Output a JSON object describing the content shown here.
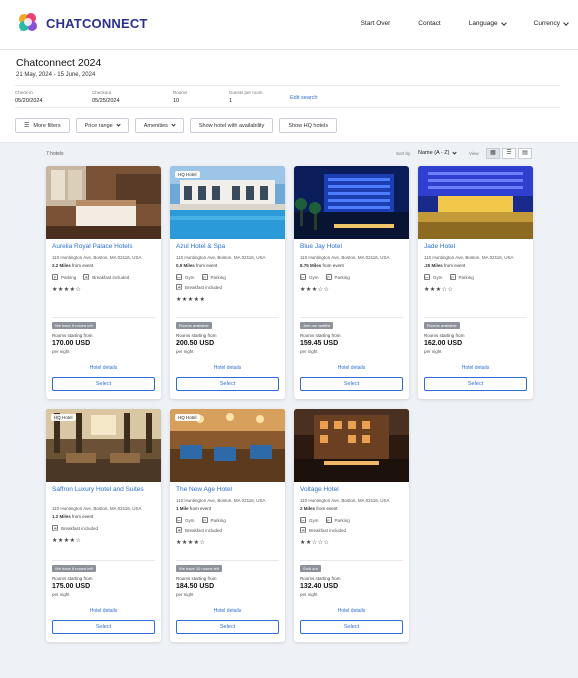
{
  "topbar": {
    "logo_text": "CHATCONNECT",
    "nav": [
      "Start Over",
      "Contact",
      "Language",
      "Currency"
    ]
  },
  "header": {
    "title": "Chatconnect 2024",
    "dates": "21 May, 2024 - 15 June, 2024",
    "fields": [
      {
        "label": "Check-in",
        "value": "05/20/2024"
      },
      {
        "label": "Checkout",
        "value": "05/25/2024"
      },
      {
        "label": "Rooms",
        "value": "10"
      },
      {
        "label": "Guests per room",
        "value": "1"
      }
    ],
    "edit_search": "Edit search"
  },
  "filters": {
    "more": "More filters",
    "price": "Price range",
    "amenities": "Amenities",
    "availability": "Show hotel with availability",
    "hq": "Show HQ hotels"
  },
  "toolbar": {
    "count": "7 hotels",
    "sort_label": "Sort by",
    "sort_value": "Name (A - Z)",
    "view_label": "View"
  },
  "hotels": [
    {
      "name": "Aurelia Royal Palace Hotels",
      "address": "110 Huntington Ave, Boston, MA 02116, USA",
      "distance": "2.2 Miles",
      "from": "from event",
      "amenities": [
        "Parking",
        "Breakfast included"
      ],
      "stars": "★★★★☆",
      "hq": "",
      "badge": "We have 6 rooms left",
      "rooms_label": "Rooms starting from",
      "price": "170.00 USD",
      "per_night": "per night",
      "details": "Hotel details",
      "select": "Select"
    },
    {
      "name": "Azul Hotel & Spa",
      "address": "110 Huntington Ave, Boston, MA 02116, USA",
      "distance": "0.5 Miles",
      "from": "from event",
      "amenities": [
        "Gym",
        "Parking",
        "Breakfast included"
      ],
      "stars": "★★★★★",
      "hq": "HQ Hotel",
      "badge": "Rooms available",
      "rooms_label": "Rooms starting from",
      "price": "200.50 USD",
      "per_night": "per night",
      "details": "Hotel details",
      "select": "Select"
    },
    {
      "name": "Blue Jay Hotel",
      "address": "110 Huntington Ave, Boston, MA 02116, USA",
      "distance": "8.75 Miles",
      "from": "from event",
      "amenities": [
        "Gym",
        "Parking"
      ],
      "stars": "★★★☆☆",
      "hq": "",
      "badge": "Join our waitlist",
      "rooms_label": "Rooms starting from",
      "price": "159.45 USD",
      "per_night": "per night",
      "details": "Hotel details",
      "select": "Select"
    },
    {
      "name": "Jade Hotel",
      "address": "110 Huntington Ave, Boston, MA 02116, USA",
      "distance": ".25 Miles",
      "from": "from event",
      "amenities": [
        "Gym",
        "Parking"
      ],
      "stars": "★★★☆☆",
      "hq": "",
      "badge": "Rooms available",
      "rooms_label": "Rooms starting from",
      "price": "162.00 USD",
      "per_night": "per night",
      "details": "Hotel details",
      "select": "Select"
    },
    {
      "name": "Saffron Luxury Hotel and Suites",
      "address": "110 Huntington Ave, Boston, MA 02116, USA",
      "distance": "1.2 Miles",
      "from": "from event",
      "amenities": [
        "Breakfast included"
      ],
      "stars": "★★★★☆",
      "hq": "HQ Hotel",
      "badge": "We have 6 rooms left",
      "rooms_label": "Rooms starting from",
      "price": "175.00 USD",
      "per_night": "per night",
      "details": "Hotel details",
      "select": "Select"
    },
    {
      "name": "The New Age Hotel",
      "address": "110 Huntington Ave, Boston, MA 02116, USA",
      "distance": "1 Mile",
      "from": "from event",
      "amenities": [
        "Gym",
        "Parking",
        "Breakfast included"
      ],
      "stars": "★★★★☆",
      "hq": "HQ Hotel",
      "badge": "We have 10 rooms left",
      "rooms_label": "Rooms starting from",
      "price": "184.50 USD",
      "per_night": "per night",
      "details": "Hotel details",
      "select": "Select"
    },
    {
      "name": "Voltage Hotel",
      "address": "110 Huntington Ave, Boston, MA 02116, USA",
      "distance": "2 Miles",
      "from": "from event",
      "amenities": [
        "Gym",
        "Parking",
        "Breakfast included"
      ],
      "stars": "★★☆☆☆",
      "hq": "",
      "badge": "Sold out",
      "rooms_label": "Rooms starting from",
      "price": "132.40 USD",
      "per_night": "per night",
      "details": "Hotel details",
      "select": "Select"
    }
  ],
  "colors": {
    "accent": "#2d6fd6",
    "brand": "#2b2f8f",
    "badge": "#8c919a"
  }
}
